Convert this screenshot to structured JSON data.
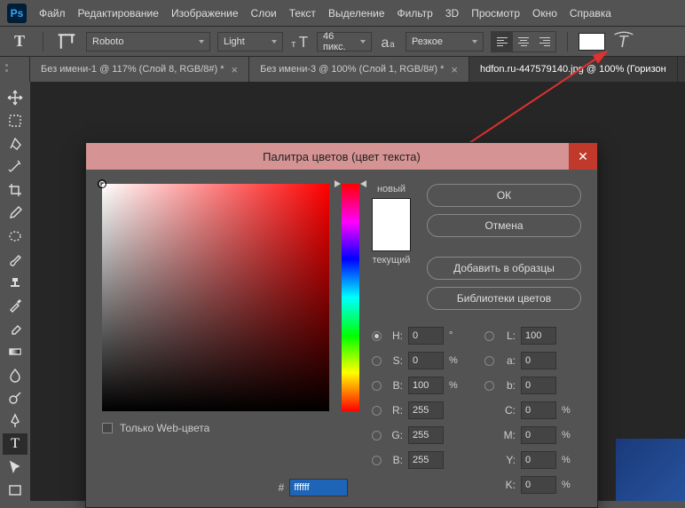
{
  "app": {
    "logo": "Ps"
  },
  "menu": [
    "Файл",
    "Редактирование",
    "Изображение",
    "Слои",
    "Текст",
    "Выделение",
    "Фильтр",
    "3D",
    "Просмотр",
    "Окно",
    "Справка"
  ],
  "options": {
    "font": "Roboto",
    "weight": "Light",
    "size": "46 пикс.",
    "aa": "Резкое"
  },
  "tabs": [
    {
      "label": "Без имени-1 @ 117% (Слой 8, RGB/8#) *",
      "active": false
    },
    {
      "label": "Без имени-3 @ 100% (Слой 1, RGB/8#) *",
      "active": false
    },
    {
      "label": "hdfon.ru-447579140.jpg @ 100% (Горизон",
      "active": true
    }
  ],
  "dialog": {
    "title": "Палитра цветов (цвет текста)",
    "new_label": "новый",
    "current_label": "текущий",
    "ok": "ОК",
    "cancel": "Отмена",
    "add_swatch": "Добавить в образцы",
    "libraries": "Библиотеки цветов",
    "webonly": "Только Web-цвета",
    "hex_label": "#",
    "hex": "ffffff",
    "fields": {
      "H": {
        "label": "H:",
        "value": "0",
        "unit": "°",
        "radio": true
      },
      "S": {
        "label": "S:",
        "value": "0",
        "unit": "%"
      },
      "Bv": {
        "label": "B:",
        "value": "100",
        "unit": "%"
      },
      "R": {
        "label": "R:",
        "value": "255"
      },
      "G": {
        "label": "G:",
        "value": "255"
      },
      "B": {
        "label": "B:",
        "value": "255"
      },
      "L": {
        "label": "L:",
        "value": "100"
      },
      "a": {
        "label": "a:",
        "value": "0"
      },
      "b": {
        "label": "b:",
        "value": "0"
      },
      "C": {
        "label": "C:",
        "value": "0",
        "unit": "%"
      },
      "M": {
        "label": "M:",
        "value": "0",
        "unit": "%"
      },
      "Y": {
        "label": "Y:",
        "value": "0",
        "unit": "%"
      },
      "K": {
        "label": "K:",
        "value": "0",
        "unit": "%"
      }
    }
  }
}
